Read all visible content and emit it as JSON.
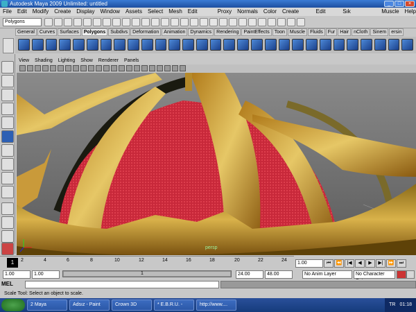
{
  "window": {
    "title": "Autodesk Maya 2009 Unlimited: untitled"
  },
  "menu": [
    "File",
    "Edit",
    "Modify",
    "Create",
    "Display",
    "Window",
    "Assets",
    "Select",
    "Mesh",
    "Edit Mesh",
    "Proxy",
    "Normals",
    "Color",
    "Create UVs",
    "Edit UVs",
    "Sık Kullanılan",
    "Muscle",
    "Help"
  ],
  "status": {
    "mode": "Polygons"
  },
  "shelf": {
    "tabs": [
      "General",
      "Curves",
      "Surfaces",
      "Polygons",
      "Subdivs",
      "Deformation",
      "Animation",
      "Dynamics",
      "Rendering",
      "PaintEffects",
      "Toon",
      "Muscle",
      "Fluids",
      "Fur",
      "Hair",
      "nCloth",
      "Sinem",
      "ersin"
    ],
    "active_index": 3
  },
  "panel": {
    "menu": [
      "View",
      "Shading",
      "Lighting",
      "Show",
      "Renderer",
      "Panels"
    ],
    "camera_label": "persp"
  },
  "timeline": {
    "current_frame": "1",
    "ticks": [
      "2",
      "4",
      "6",
      "8",
      "10",
      "12",
      "14",
      "16",
      "18",
      "20",
      "22",
      "24"
    ],
    "current_time": "1.00"
  },
  "range": {
    "start": "1.00",
    "playback_start": "1.00",
    "slider_label": "1",
    "playback_end": "24.00",
    "end": "48.00",
    "anim_layer": "No Anim Layer",
    "char_set": "No Character Set"
  },
  "mel": {
    "label": "MEL"
  },
  "help": {
    "text": "Scale Tool: Select an object to scale."
  },
  "taskbar": {
    "items": [
      "2 Maya",
      "Adsız - Paint",
      "Crown 3D",
      "* E.B.R.U. -",
      "http://www...."
    ],
    "lang": "TR",
    "clock": "01:18"
  }
}
